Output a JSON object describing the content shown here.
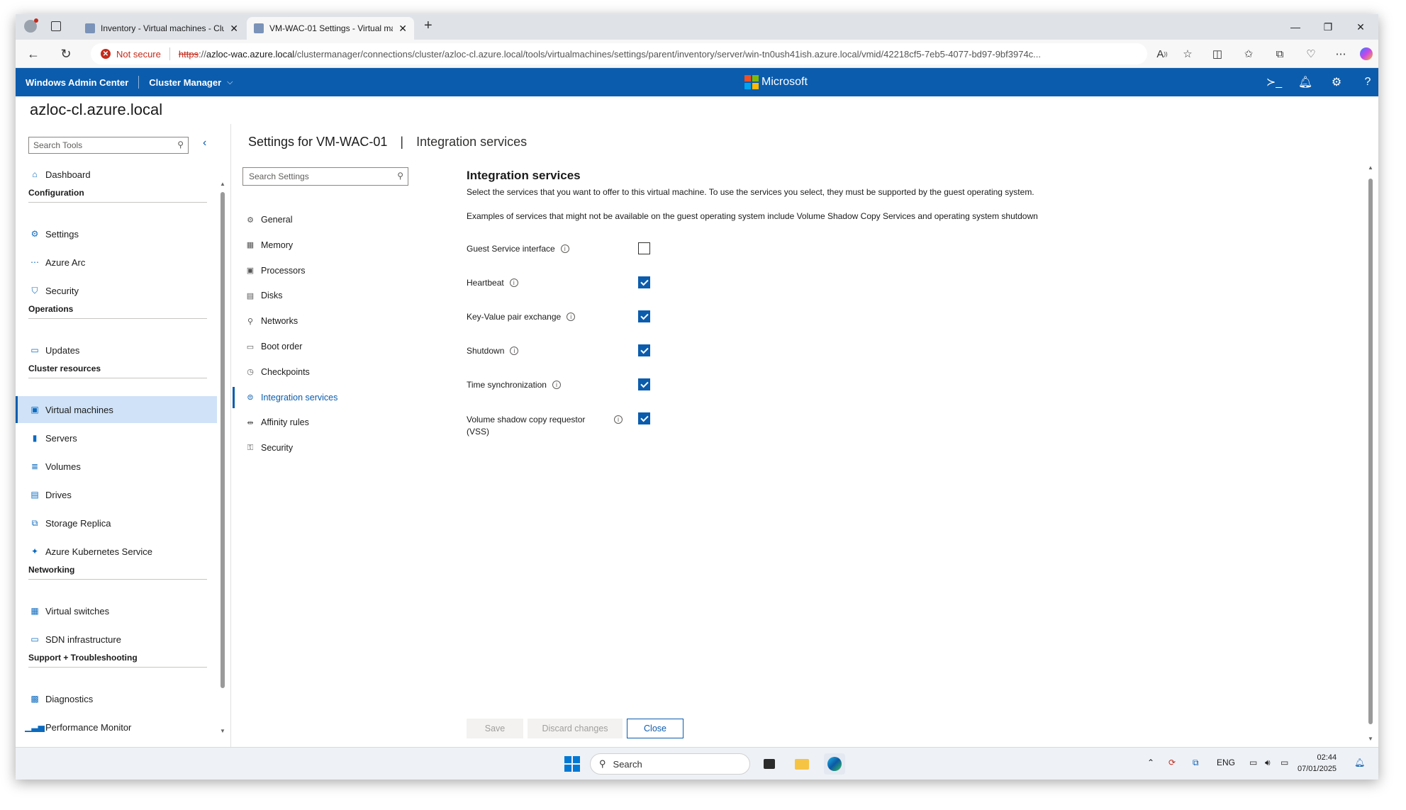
{
  "browser": {
    "tabs": [
      {
        "title": "Inventory - Virtual machines - Clu",
        "active": false
      },
      {
        "title": "VM-WAC-01 Settings - Virtual ma",
        "active": true
      }
    ],
    "new_tab": "+",
    "window_controls": {
      "minimize": "—",
      "restore": "❐",
      "close": "✕"
    },
    "address": {
      "security_label": "Not secure",
      "scheme": "https",
      "host": "azloc-wac.azure.local",
      "path": "/clustermanager/connections/cluster/azloc-cl.azure.local/tools/virtualmachines/settings/parent/inventory/server/win-tn0ush41ish.azure.local/vmid/42218cf5-7eb5-4077-bd97-9bf3974c..."
    }
  },
  "header": {
    "brand": "Windows Admin Center",
    "context": "Cluster Manager",
    "center_logo_text": "Microsoft",
    "logo_colors": [
      "#f25022",
      "#7fba00",
      "#00a4ef",
      "#ffb900"
    ],
    "accent": "#0b5cad"
  },
  "page": {
    "title": "azloc-cl.azure.local"
  },
  "left_nav": {
    "search_placeholder": "Search Tools",
    "items": [
      {
        "label": "Dashboard",
        "icon": "home-icon",
        "glyph": "⌂"
      },
      {
        "group": "Configuration"
      },
      {
        "label": "Settings",
        "icon": "gear-icon",
        "glyph": "⚙"
      },
      {
        "label": "Azure Arc",
        "icon": "azure-arc-icon",
        "glyph": "⋯"
      },
      {
        "label": "Security",
        "icon": "shield-icon",
        "glyph": "⛉"
      },
      {
        "group": "Operations"
      },
      {
        "label": "Updates",
        "icon": "updates-icon",
        "glyph": "▭"
      },
      {
        "group": "Cluster resources"
      },
      {
        "label": "Virtual machines",
        "icon": "virtual-machine-icon",
        "glyph": "▣",
        "selected": true
      },
      {
        "label": "Servers",
        "icon": "server-icon",
        "glyph": "▮"
      },
      {
        "label": "Volumes",
        "icon": "volumes-icon",
        "glyph": "≣"
      },
      {
        "label": "Drives",
        "icon": "drive-icon",
        "glyph": "▤"
      },
      {
        "label": "Storage Replica",
        "icon": "storage-replica-icon",
        "glyph": "⧉"
      },
      {
        "label": "Azure Kubernetes Service",
        "icon": "kubernetes-icon",
        "glyph": "✦"
      },
      {
        "group": "Networking"
      },
      {
        "label": "Virtual switches",
        "icon": "virtual-switch-icon",
        "glyph": "▦"
      },
      {
        "label": "SDN infrastructure",
        "icon": "sdn-icon",
        "glyph": "▭"
      },
      {
        "group": "Support + Troubleshooting"
      },
      {
        "label": "Diagnostics",
        "icon": "diagnostics-icon",
        "glyph": "▩"
      },
      {
        "label": "Performance Monitor",
        "icon": "performance-monitor-icon",
        "glyph": "▁▃▅"
      }
    ]
  },
  "settings": {
    "title": "Settings for VM-WAC-01",
    "separator": "|",
    "subtitle": "Integration services",
    "search_placeholder": "Search Settings",
    "nav": [
      {
        "label": "General",
        "icon": "gear-icon",
        "glyph": "⚙"
      },
      {
        "label": "Memory",
        "icon": "memory-icon",
        "glyph": "▦"
      },
      {
        "label": "Processors",
        "icon": "processor-icon",
        "glyph": "▣"
      },
      {
        "label": "Disks",
        "icon": "disk-icon",
        "glyph": "▤"
      },
      {
        "label": "Networks",
        "icon": "network-icon",
        "glyph": "⚲"
      },
      {
        "label": "Boot order",
        "icon": "boot-order-icon",
        "glyph": "▭"
      },
      {
        "label": "Checkpoints",
        "icon": "checkpoint-icon",
        "glyph": "◷"
      },
      {
        "label": "Integration services",
        "icon": "integration-services-icon",
        "glyph": "⊜",
        "selected": true
      },
      {
        "label": "Affinity rules",
        "icon": "affinity-rules-icon",
        "glyph": "⇹"
      },
      {
        "label": "Security",
        "icon": "security-icon",
        "glyph": "⚿"
      }
    ]
  },
  "content": {
    "heading": "Integration services",
    "description": "Select the services that you want to offer to this virtual machine. To use the services you select, they must be supported by the guest operating system.",
    "examples": "Examples of services that might not be available on the guest operating system include Volume Shadow Copy Services and operating system shutdown",
    "services": [
      {
        "label": "Guest Service interface",
        "checked": false
      },
      {
        "label": "Heartbeat",
        "checked": true
      },
      {
        "label": "Key-Value pair exchange",
        "checked": true
      },
      {
        "label": "Shutdown",
        "checked": true
      },
      {
        "label": "Time synchronization",
        "checked": true
      },
      {
        "label": "Volume shadow copy requestor (VSS)",
        "checked": true
      }
    ],
    "buttons": {
      "save": "Save",
      "discard": "Discard changes",
      "close": "Close"
    }
  },
  "taskbar": {
    "search_placeholder": "Search",
    "language": "ENG",
    "time": "02:44",
    "date": "07/01/2025"
  }
}
